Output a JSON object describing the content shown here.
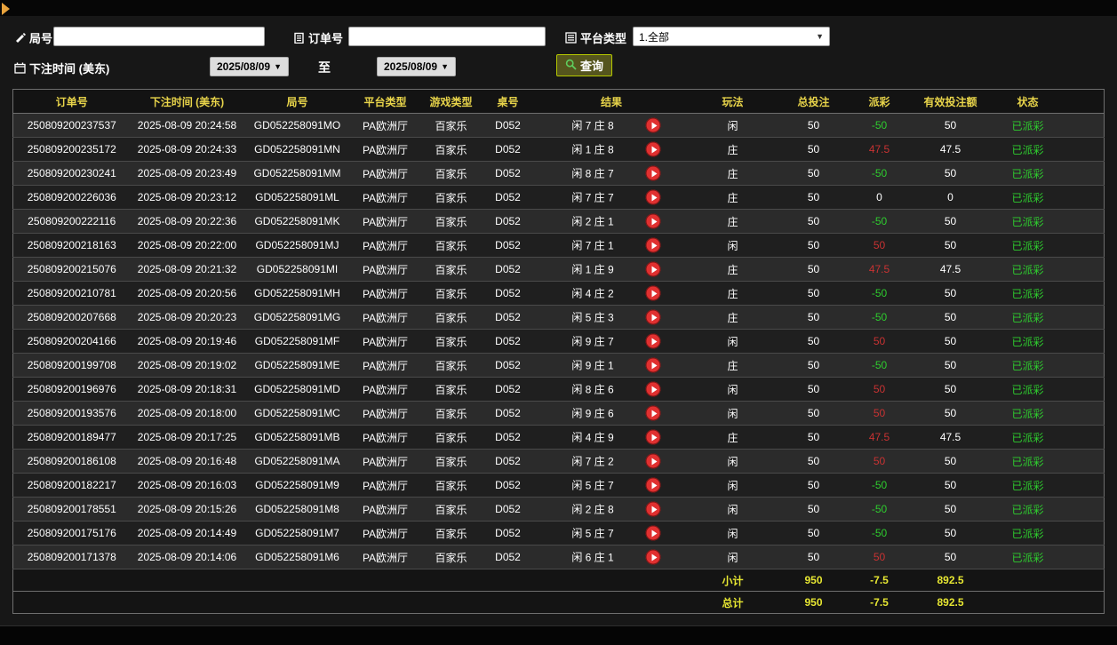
{
  "colors": {
    "header_text": "#e8d44a",
    "win_red": "#c83232",
    "lose_green": "#2ecc2e",
    "status_green": "#2ecc2e",
    "totals_yellow": "#e6e632",
    "query_button_border": "#b5c800",
    "play_button_red": "#e03030",
    "collapse_arrow_orange": "#e8a33d"
  },
  "filters": {
    "round_no_label": "局号",
    "round_no_value": "",
    "order_no_label": "订单号",
    "order_no_value": "",
    "platform_type_label": "平台类型",
    "platform_type_value": "1.全部",
    "bet_time_label": "下注时间 (美东)",
    "date_from": "2025/08/09",
    "to_label": "至",
    "date_to": "2025/08/09",
    "query_button_label": "查询"
  },
  "table": {
    "headers": [
      "订单号",
      "下注时间 (美东)",
      "局号",
      "平台类型",
      "游戏类型",
      "桌号",
      "结果",
      "玩法",
      "总投注",
      "派彩",
      "有效投注额",
      "状态"
    ],
    "rows": [
      {
        "order_no": "250809200237537",
        "bet_time": "2025-08-09 20:24:58",
        "round_no": "GD052258091MO",
        "platform": "PA欧洲厅",
        "game_type": "百家乐",
        "table_no": "D052",
        "result": "闲 7 庄 8",
        "play": "闲",
        "total_bet": "50",
        "payout": "-50",
        "payout_class": "green",
        "valid_bet": "50",
        "status": "已派彩"
      },
      {
        "order_no": "250809200235172",
        "bet_time": "2025-08-09 20:24:33",
        "round_no": "GD052258091MN",
        "platform": "PA欧洲厅",
        "game_type": "百家乐",
        "table_no": "D052",
        "result": "闲 1 庄 8",
        "play": "庄",
        "total_bet": "50",
        "payout": "47.5",
        "payout_class": "red",
        "valid_bet": "47.5",
        "status": "已派彩"
      },
      {
        "order_no": "250809200230241",
        "bet_time": "2025-08-09 20:23:49",
        "round_no": "GD052258091MM",
        "platform": "PA欧洲厅",
        "game_type": "百家乐",
        "table_no": "D052",
        "result": "闲 8 庄 7",
        "play": "庄",
        "total_bet": "50",
        "payout": "-50",
        "payout_class": "green",
        "valid_bet": "50",
        "status": "已派彩"
      },
      {
        "order_no": "250809200226036",
        "bet_time": "2025-08-09 20:23:12",
        "round_no": "GD052258091ML",
        "platform": "PA欧洲厅",
        "game_type": "百家乐",
        "table_no": "D052",
        "result": "闲 7 庄 7",
        "play": "庄",
        "total_bet": "50",
        "payout": "0",
        "payout_class": "plain",
        "valid_bet": "0",
        "status": "已派彩"
      },
      {
        "order_no": "250809200222116",
        "bet_time": "2025-08-09 20:22:36",
        "round_no": "GD052258091MK",
        "platform": "PA欧洲厅",
        "game_type": "百家乐",
        "table_no": "D052",
        "result": "闲 2 庄 1",
        "play": "庄",
        "total_bet": "50",
        "payout": "-50",
        "payout_class": "green",
        "valid_bet": "50",
        "status": "已派彩"
      },
      {
        "order_no": "250809200218163",
        "bet_time": "2025-08-09 20:22:00",
        "round_no": "GD052258091MJ",
        "platform": "PA欧洲厅",
        "game_type": "百家乐",
        "table_no": "D052",
        "result": "闲 7 庄 1",
        "play": "闲",
        "total_bet": "50",
        "payout": "50",
        "payout_class": "red",
        "valid_bet": "50",
        "status": "已派彩"
      },
      {
        "order_no": "250809200215076",
        "bet_time": "2025-08-09 20:21:32",
        "round_no": "GD052258091MI",
        "platform": "PA欧洲厅",
        "game_type": "百家乐",
        "table_no": "D052",
        "result": "闲 1 庄 9",
        "play": "庄",
        "total_bet": "50",
        "payout": "47.5",
        "payout_class": "red",
        "valid_bet": "47.5",
        "status": "已派彩"
      },
      {
        "order_no": "250809200210781",
        "bet_time": "2025-08-09 20:20:56",
        "round_no": "GD052258091MH",
        "platform": "PA欧洲厅",
        "game_type": "百家乐",
        "table_no": "D052",
        "result": "闲 4 庄 2",
        "play": "庄",
        "total_bet": "50",
        "payout": "-50",
        "payout_class": "green",
        "valid_bet": "50",
        "status": "已派彩"
      },
      {
        "order_no": "250809200207668",
        "bet_time": "2025-08-09 20:20:23",
        "round_no": "GD052258091MG",
        "platform": "PA欧洲厅",
        "game_type": "百家乐",
        "table_no": "D052",
        "result": "闲 5 庄 3",
        "play": "庄",
        "total_bet": "50",
        "payout": "-50",
        "payout_class": "green",
        "valid_bet": "50",
        "status": "已派彩"
      },
      {
        "order_no": "250809200204166",
        "bet_time": "2025-08-09 20:19:46",
        "round_no": "GD052258091MF",
        "platform": "PA欧洲厅",
        "game_type": "百家乐",
        "table_no": "D052",
        "result": "闲 9 庄 7",
        "play": "闲",
        "total_bet": "50",
        "payout": "50",
        "payout_class": "red",
        "valid_bet": "50",
        "status": "已派彩"
      },
      {
        "order_no": "250809200199708",
        "bet_time": "2025-08-09 20:19:02",
        "round_no": "GD052258091ME",
        "platform": "PA欧洲厅",
        "game_type": "百家乐",
        "table_no": "D052",
        "result": "闲 9 庄 1",
        "play": "庄",
        "total_bet": "50",
        "payout": "-50",
        "payout_class": "green",
        "valid_bet": "50",
        "status": "已派彩"
      },
      {
        "order_no": "250809200196976",
        "bet_time": "2025-08-09 20:18:31",
        "round_no": "GD052258091MD",
        "platform": "PA欧洲厅",
        "game_type": "百家乐",
        "table_no": "D052",
        "result": "闲 8 庄 6",
        "play": "闲",
        "total_bet": "50",
        "payout": "50",
        "payout_class": "red",
        "valid_bet": "50",
        "status": "已派彩"
      },
      {
        "order_no": "250809200193576",
        "bet_time": "2025-08-09 20:18:00",
        "round_no": "GD052258091MC",
        "platform": "PA欧洲厅",
        "game_type": "百家乐",
        "table_no": "D052",
        "result": "闲 9 庄 6",
        "play": "闲",
        "total_bet": "50",
        "payout": "50",
        "payout_class": "red",
        "valid_bet": "50",
        "status": "已派彩"
      },
      {
        "order_no": "250809200189477",
        "bet_time": "2025-08-09 20:17:25",
        "round_no": "GD052258091MB",
        "platform": "PA欧洲厅",
        "game_type": "百家乐",
        "table_no": "D052",
        "result": "闲 4 庄 9",
        "play": "庄",
        "total_bet": "50",
        "payout": "47.5",
        "payout_class": "red",
        "valid_bet": "47.5",
        "status": "已派彩"
      },
      {
        "order_no": "250809200186108",
        "bet_time": "2025-08-09 20:16:48",
        "round_no": "GD052258091MA",
        "platform": "PA欧洲厅",
        "game_type": "百家乐",
        "table_no": "D052",
        "result": "闲 7 庄 2",
        "play": "闲",
        "total_bet": "50",
        "payout": "50",
        "payout_class": "red",
        "valid_bet": "50",
        "status": "已派彩"
      },
      {
        "order_no": "250809200182217",
        "bet_time": "2025-08-09 20:16:03",
        "round_no": "GD052258091M9",
        "platform": "PA欧洲厅",
        "game_type": "百家乐",
        "table_no": "D052",
        "result": "闲 5 庄 7",
        "play": "闲",
        "total_bet": "50",
        "payout": "-50",
        "payout_class": "green",
        "valid_bet": "50",
        "status": "已派彩"
      },
      {
        "order_no": "250809200178551",
        "bet_time": "2025-08-09 20:15:26",
        "round_no": "GD052258091M8",
        "platform": "PA欧洲厅",
        "game_type": "百家乐",
        "table_no": "D052",
        "result": "闲 2 庄 8",
        "play": "闲",
        "total_bet": "50",
        "payout": "-50",
        "payout_class": "green",
        "valid_bet": "50",
        "status": "已派彩"
      },
      {
        "order_no": "250809200175176",
        "bet_time": "2025-08-09 20:14:49",
        "round_no": "GD052258091M7",
        "platform": "PA欧洲厅",
        "game_type": "百家乐",
        "table_no": "D052",
        "result": "闲 5 庄 7",
        "play": "闲",
        "total_bet": "50",
        "payout": "-50",
        "payout_class": "green",
        "valid_bet": "50",
        "status": "已派彩"
      },
      {
        "order_no": "250809200171378",
        "bet_time": "2025-08-09 20:14:06",
        "round_no": "GD052258091M6",
        "platform": "PA欧洲厅",
        "game_type": "百家乐",
        "table_no": "D052",
        "result": "闲 6 庄 1",
        "play": "闲",
        "total_bet": "50",
        "payout": "50",
        "payout_class": "red",
        "valid_bet": "50",
        "status": "已派彩"
      }
    ],
    "subtotal": {
      "label": "小计",
      "total_bet": "950",
      "payout": "-7.5",
      "valid_bet": "892.5"
    },
    "total": {
      "label": "总计",
      "total_bet": "950",
      "payout": "-7.5",
      "valid_bet": "892.5"
    }
  }
}
